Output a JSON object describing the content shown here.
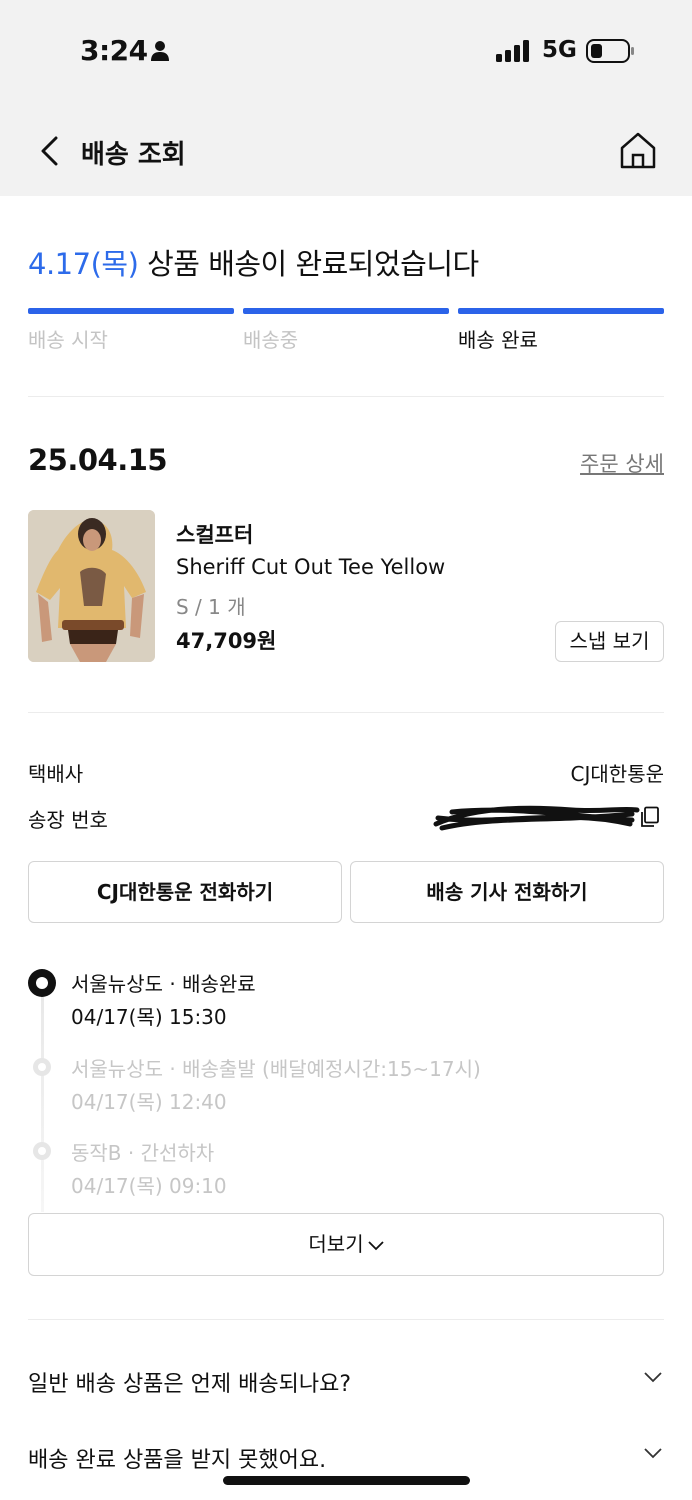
{
  "status_bar": {
    "time": "3:24",
    "network": "5G"
  },
  "header": {
    "title": "배송 조회"
  },
  "delivery_status": {
    "date": "4.17(목)",
    "message": "상품 배송이 완료되었습니다",
    "steps": [
      "배송 시작",
      "배송중",
      "배송 완료"
    ],
    "current_step": 3
  },
  "order": {
    "date": "25.04.15",
    "detail_link": "주문 상세",
    "product": {
      "brand": "스컬프터",
      "name": "Sheriff Cut Out Tee Yellow",
      "option": "S / 1 개",
      "price": "47,709원",
      "snap_button": "스냅 보기"
    }
  },
  "shipping": {
    "courier_label": "택배사",
    "courier_value": "CJ대한통운",
    "tracking_label": "송장 번호",
    "call_courier_button": "CJ대한통운 전화하기",
    "call_driver_button": "배송 기사 전화하기"
  },
  "timeline": [
    {
      "title": "서울뉴상도 · 배송완료",
      "time": "04/17(목) 15:30"
    },
    {
      "title": "서울뉴상도 · 배송출발 (배달예정시간:15~17시)",
      "time": "04/17(목) 12:40"
    },
    {
      "title": "동작B · 간선하차",
      "time": "04/17(목) 09:10"
    }
  ],
  "more_button": "더보기",
  "faq": [
    "일반 배송 상품은 언제 배송되나요?",
    "배송 완료 상품을 받지 못했어요."
  ],
  "colors": {
    "accent": "#2b63e9",
    "headline_date": "#2d6bea"
  }
}
